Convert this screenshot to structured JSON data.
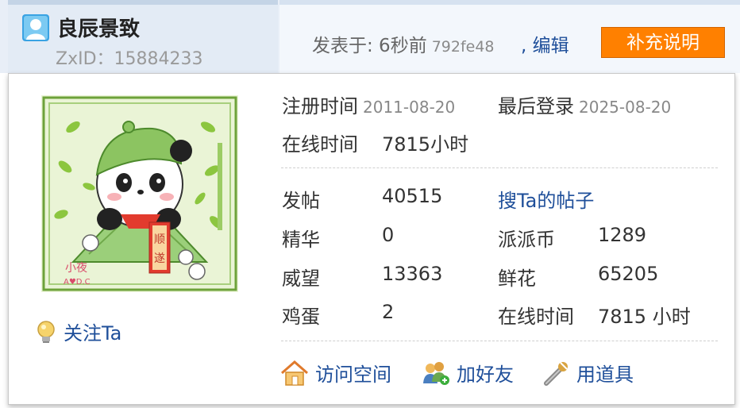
{
  "author": {
    "username": "良辰景致",
    "zxid": "ZxID：15884233"
  },
  "post": {
    "posted_at": "发表于: 6秒前",
    "hash": "792fe48",
    "edit_label": ", 编辑",
    "supplement_button": "补充说明"
  },
  "avatar": {
    "description_text": "小夜",
    "credit": "A♥D.C",
    "scroll_text": "顺遂"
  },
  "follow_label": "关注Ta",
  "profile": {
    "register_label": "注册时间",
    "register_date": "2011-08-20",
    "last_login_label": "最后登录",
    "last_login_date": "2025-08-20",
    "online_label": "在线时间",
    "online_value": "7815小时"
  },
  "stats": {
    "posts_label": "发帖",
    "posts_value": "40515",
    "search_posts_link": "搜Ta的帖子",
    "digest_label": "精华",
    "digest_value": "0",
    "coins_label": "派派币",
    "coins_value": "1289",
    "prestige_label": "威望",
    "prestige_value": "13363",
    "flowers_label": "鲜花",
    "flowers_value": "65205",
    "eggs_label": "鸡蛋",
    "eggs_value": "2",
    "online_label": "在线时间",
    "online_value": "7815 小时"
  },
  "actions": {
    "visit_space": "访问空间",
    "add_friend": "加好友",
    "use_item": "用道具"
  },
  "colors": {
    "link": "#1f4f9a",
    "button": "#ff8000",
    "avatar_bg": "#eaf4d6"
  }
}
